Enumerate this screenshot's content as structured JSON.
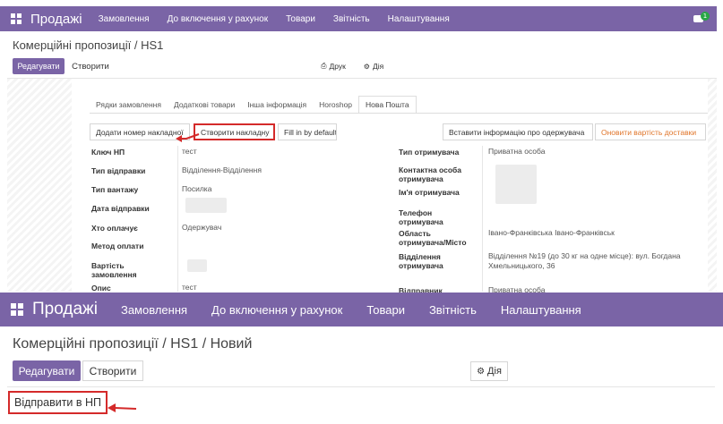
{
  "top": {
    "app_title": "Продажі",
    "menu": [
      "Замовлення",
      "До включення у рахунок",
      "Товари",
      "Звітність",
      "Налаштування"
    ],
    "notification_count": "1",
    "breadcrumb": "Комерційні пропозиції / HS1",
    "edit_label": "Редагувати",
    "create_label": "Створити",
    "print_label": "Друк",
    "action_label": "Дія",
    "tabs": [
      "Рядки замовлення",
      "Додаткові товари",
      "Інша інформація",
      "Horoshop",
      "Нова Пошта"
    ],
    "buttons": {
      "add_number": "Додати номер накладної",
      "create_waybill": "Створити накладну",
      "fill_default": "Fill in by default",
      "insert_recipient": "Вставити інформацію про одержувача",
      "update_cost": "Оновити вартість доставки"
    },
    "left_fields": [
      {
        "label": "Ключ НП",
        "value": "тест"
      },
      {
        "label": "Тип відправки",
        "value": "Відділення-Відділення"
      },
      {
        "label": "Тип вантажу",
        "value": "Посилка"
      },
      {
        "label": "Дата відправки",
        "value": ""
      },
      {
        "label": "Хто оплачує",
        "value": "Одержувач"
      },
      {
        "label": "Метод оплати",
        "value": ""
      },
      {
        "label": "Вартість замовлення",
        "value": ""
      },
      {
        "label": "Опис",
        "value": "тест"
      }
    ],
    "right_fields": [
      {
        "label": "Тип отримувача",
        "value": "Приватна особа"
      },
      {
        "label": "Контактна особа отримувача",
        "value": ""
      },
      {
        "label": "Ім'я отримувача",
        "value": ""
      },
      {
        "label": "Телефон отримувача",
        "value": ""
      },
      {
        "label": "Область отримувача/Місто",
        "value": "Івано-Франківська   Івано-Франківськ"
      },
      {
        "label": "Відділення отримувача",
        "value": "Відділення №19 (до 30 кг на одне місце): вул. Богдана Хмельницького, 36"
      },
      {
        "label": "Відправник",
        "value": "Приватна особа"
      }
    ]
  },
  "bottom": {
    "app_title": "Продажі",
    "menu": [
      "Замовлення",
      "До включення у рахунок",
      "Товари",
      "Звітність",
      "Налаштування"
    ],
    "breadcrumb": "Комерційні пропозиції / HS1 / Новий",
    "edit_label": "Редагувати",
    "create_label": "Створити",
    "action_label": "Дія",
    "send_label": "Відправити в НП"
  },
  "colors": {
    "navbar": "#7a64a6",
    "highlight": "#d42a2a",
    "update_cost_text": "#e0752a",
    "badge": "#28a745"
  }
}
